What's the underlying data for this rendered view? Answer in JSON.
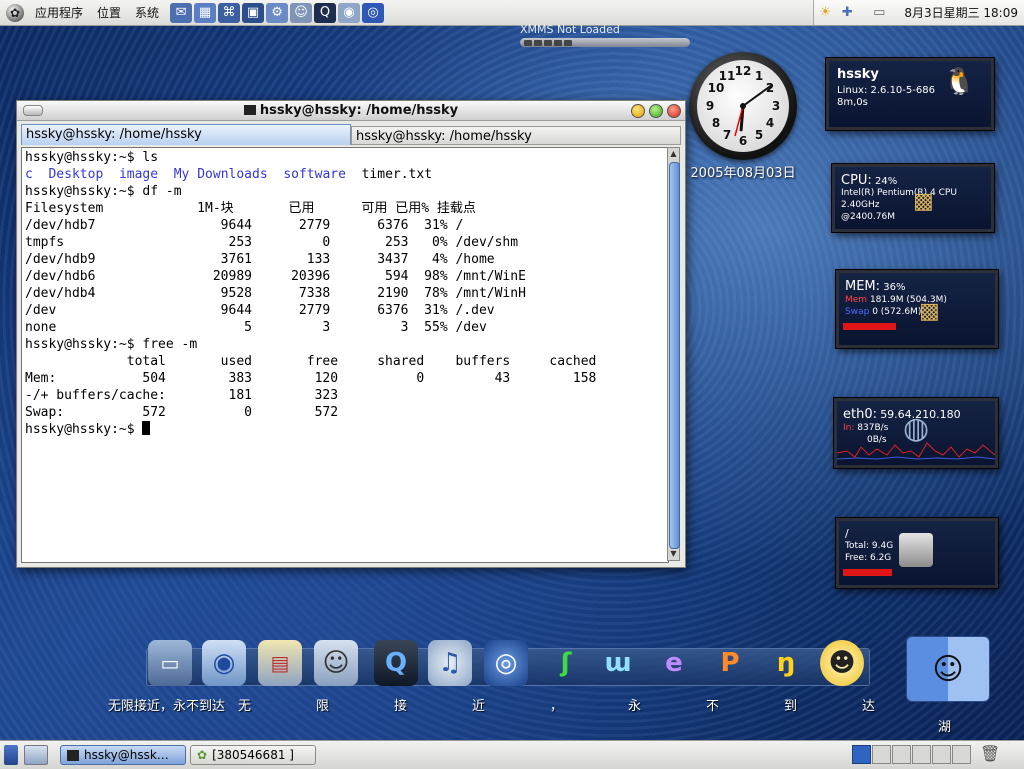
{
  "top_panel": {
    "menus": [
      "应用程序",
      "位置",
      "系统"
    ],
    "launchers": [
      "mail-icon",
      "calendar-icon",
      "network-icon",
      "terminal-icon",
      "settings-icon",
      "user-icon",
      "quicktime-icon",
      "globe-icon",
      "chat-icon"
    ],
    "clock": "8月3日星期三 18:09"
  },
  "xmms": {
    "title": "XMMS Not Loaded"
  },
  "desktop_clock": {
    "date": "2005年08月03日",
    "time_hour": 6,
    "time_min": 9
  },
  "terminal": {
    "title": "hssky@hssky: /home/hssky",
    "tabs": [
      "hssky@hssky: /home/hssky",
      "hssky@hssky: /home/hssky"
    ],
    "lines": [
      "hssky@hssky:~$ ls",
      "",
      "hssky@hssky:~$ df -m",
      "Filesystem            1M-块       已用      可用 已用% 挂载点",
      "/dev/hdb7                9644      2779      6376  31% /",
      "tmpfs                     253         0       253   0% /dev/shm",
      "/dev/hdb9                3761       133      3437   4% /home",
      "/dev/hdb6               20989     20396       594  98% /mnt/WinE",
      "/dev/hdb4                9528      7338      2190  78% /mnt/WinH",
      "/dev                     9644      2779      6376  31% /.dev",
      "none                        5         3         3  55% /dev",
      "hssky@hssky:~$ free -m",
      "             total       used       free     shared    buffers     cached",
      "Mem:           504        383        120          0         43        158",
      "-/+ buffers/cache:        181        323",
      "Swap:          572          0        572",
      "hssky@hssky:~$ "
    ],
    "ls_blue": [
      "c",
      "Desktop",
      "image",
      "My Downloads",
      "software"
    ],
    "ls_plain": "timer.txt"
  },
  "monitors": {
    "host": {
      "name": "hssky",
      "kernel": "Linux: 2.6.10-5-686",
      "uptime": "8m,0s"
    },
    "cpu": {
      "label": "CPU:",
      "percent": "24%",
      "model": "Intel(R) Pentium(R) 4 CPU",
      "freq": "2.40GHz",
      "mhz": "@2400.76M"
    },
    "mem": {
      "label": "MEM:",
      "percent": "36%",
      "mem_tag": "Mem",
      "mem_val": "181.9M (504.3M)",
      "swap_tag": "Swap",
      "swap_val": "0 (572.6M)",
      "fill": 0.36
    },
    "net": {
      "label": "eth0:",
      "ip": "59.64.210.180",
      "in_tag": "In:",
      "in_val": "837B/s",
      "out_val": "0B/s"
    },
    "disk": {
      "label": "/",
      "total": "Total: 9.4G",
      "free": "Free: 6.2G",
      "fill": 0.66
    }
  },
  "dock": {
    "labels": [
      "无限接近，永不到达",
      "无",
      "限",
      "接",
      "近",
      "，",
      "永",
      "不",
      "到",
      "达"
    ],
    "finder_label": "湖"
  },
  "bottom_panel": {
    "tasks": [
      "hssky@hssk…",
      "[380546681 ]"
    ]
  },
  "colors": {
    "term_blue": "#3535e0",
    "accent_red": "#e01515",
    "panel": "#e4e4e0"
  }
}
